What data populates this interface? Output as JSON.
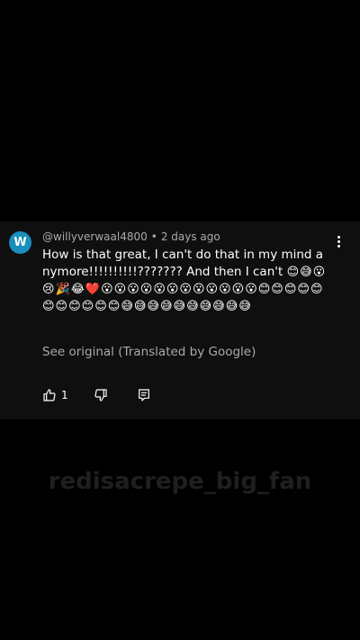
{
  "comment": {
    "avatar_letter": "W",
    "avatar_color": "#1a8fbe",
    "username": "@willyverwaal4800",
    "separator": "•",
    "timestamp": "2 days ago",
    "text": "How is that great, I can't do that in my mind anymore!!!!!!!!!!??????? And then I can't",
    "emojis": "😊😅😮😢🎉😂❤️😮😮😮😮😮😮😮😮😮😮😮😮😊😊😊😊😊😊😊😊😊😊😊😅😅😅😅😅😅😅😅😅😅",
    "see_original": "See original (Translated by Google)",
    "like_count": "1",
    "icons": [
      "thumbs-up-icon",
      "thumbs-down-icon",
      "reply-icon",
      "more-vertical-icon"
    ]
  },
  "watermark": "redisacrepe_big_fan"
}
